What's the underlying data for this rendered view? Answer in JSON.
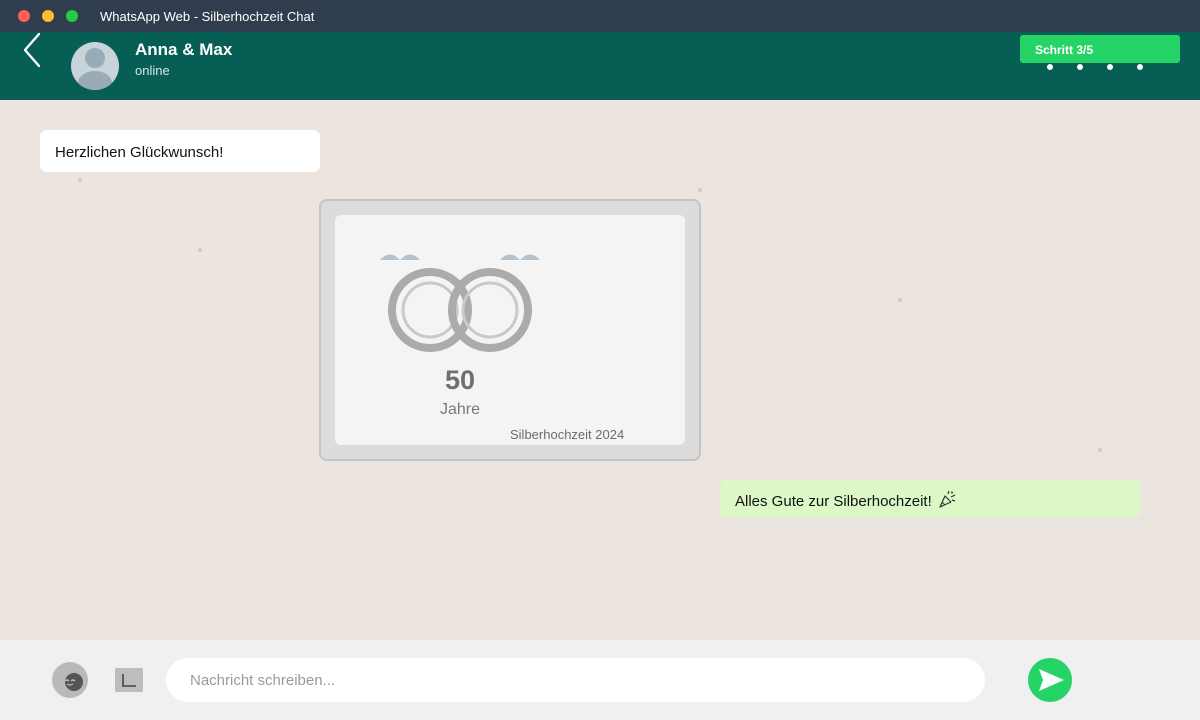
{
  "window": {
    "title": "WhatsApp Web - Silberhochzeit Chat",
    "controls": [
      "close",
      "minimize",
      "maximize"
    ]
  },
  "header": {
    "contact_name": "Anna & Max",
    "status": "online",
    "step_label": "Schritt 3/5",
    "icons": [
      "back-icon",
      "avatar-placeholder-icon",
      "menu-dots-icon"
    ]
  },
  "messages": [
    {
      "direction": "incoming",
      "text": "Herzlichen Glückwunsch!"
    },
    {
      "direction": "incoming",
      "type": "image",
      "image": {
        "number": "50",
        "unit": "Jahre",
        "caption": "Silberhochzeit 2024"
      }
    },
    {
      "direction": "outgoing",
      "text": "Alles Gute zur Silberhochzeit!",
      "emoji": "🎉"
    }
  ],
  "composer": {
    "placeholder": "Nachricht schreiben...",
    "value": "",
    "icons": [
      "emoji-icon",
      "attach-icon",
      "send-icon"
    ]
  },
  "colors": {
    "titlebar": "#2f3d4e",
    "header": "#075e54",
    "chat_background": "#ece5df",
    "incoming_bubble": "#ffffff",
    "outgoing_bubble": "#dcf8c6",
    "accent": "#25d366"
  }
}
